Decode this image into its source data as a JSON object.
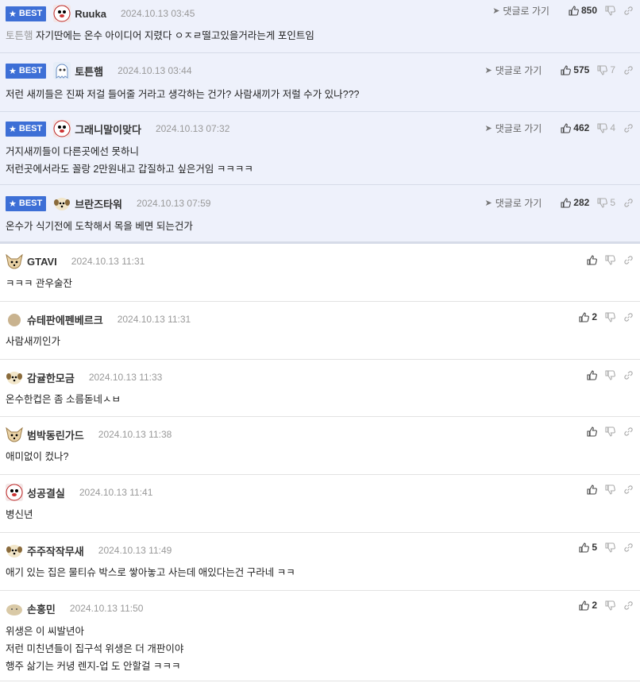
{
  "reply_label": "댓글로 가기",
  "best_label": "BEST",
  "best_comments": [
    {
      "nick": "Ruuka",
      "date": "2024.10.13 03:45",
      "ref": "토튼햄",
      "text": " 자기딴에는 온수 아이디어 지렸다 ㅇㅈㄹ떨고있을거라는게 포인트임",
      "up": "850",
      "down": "",
      "avatar": "dog-face"
    },
    {
      "nick": "토튼햄",
      "date": "2024.10.13 03:44",
      "ref": "",
      "text": "저런 새끼들은 진짜 저걸 들어줄 거라고 생각하는 건가? 사람새끼가 저럴 수가 있나???",
      "up": "575",
      "down": "7",
      "avatar": "ghost"
    },
    {
      "nick": "그래니말이맞다",
      "date": "2024.10.13 07:32",
      "ref": "",
      "text": "거지새끼들이 다른곳에선 못하니\n저런곳에서라도 꼴랑 2만원내고 갑질하고 싶은거임 ㅋㅋㅋㅋ",
      "up": "462",
      "down": "4",
      "avatar": "dog-face"
    },
    {
      "nick": "브란즈타워",
      "date": "2024.10.13 07:59",
      "ref": "",
      "text": "온수가 식기전에 도착해서 목을 베면 되는건가",
      "up": "282",
      "down": "5",
      "avatar": "puppy"
    }
  ],
  "comments": [
    {
      "nick": "GTAVI",
      "date": "2024.10.13 11:31",
      "text": "ㅋㅋㅋ 관우술잔",
      "up": "",
      "avatar": "chihuahua"
    },
    {
      "nick": "슈테판에펜베르크",
      "date": "2024.10.13 11:31",
      "text": "사람새끼인가",
      "up": "2",
      "avatar": "circle"
    },
    {
      "nick": "감귤한모금",
      "date": "2024.10.13 11:33",
      "text": "온수한컵은 좀 소름돋네ㅅㅂ",
      "up": "",
      "avatar": "puppy"
    },
    {
      "nick": "범박동린가드",
      "date": "2024.10.13 11:38",
      "text": "애미없이 컸나?",
      "up": "",
      "avatar": "chihuahua"
    },
    {
      "nick": "성공결실",
      "date": "2024.10.13 11:41",
      "text": "병신년",
      "up": "",
      "avatar": "dog-face"
    },
    {
      "nick": "주주작작무새",
      "date": "2024.10.13 11:49",
      "text": "애기 있는 집은 물티슈 박스로 쌓아놓고 사는데 애있다는건 구라네 ㅋㅋ",
      "up": "5",
      "avatar": "puppy"
    },
    {
      "nick": "손홍민",
      "date": "2024.10.13 11:50",
      "text": "위생은 이 씨발년아\n저런 미친년들이 집구석 위생은 더 개판이야\n행주 삶기는 커녕 렌지-업 도 안할걸 ㅋㅋㅋ",
      "up": "2",
      "avatar": "blob"
    }
  ],
  "colors": {
    "best_bg": "#eef1fb",
    "badge": "#3d6fd6"
  }
}
